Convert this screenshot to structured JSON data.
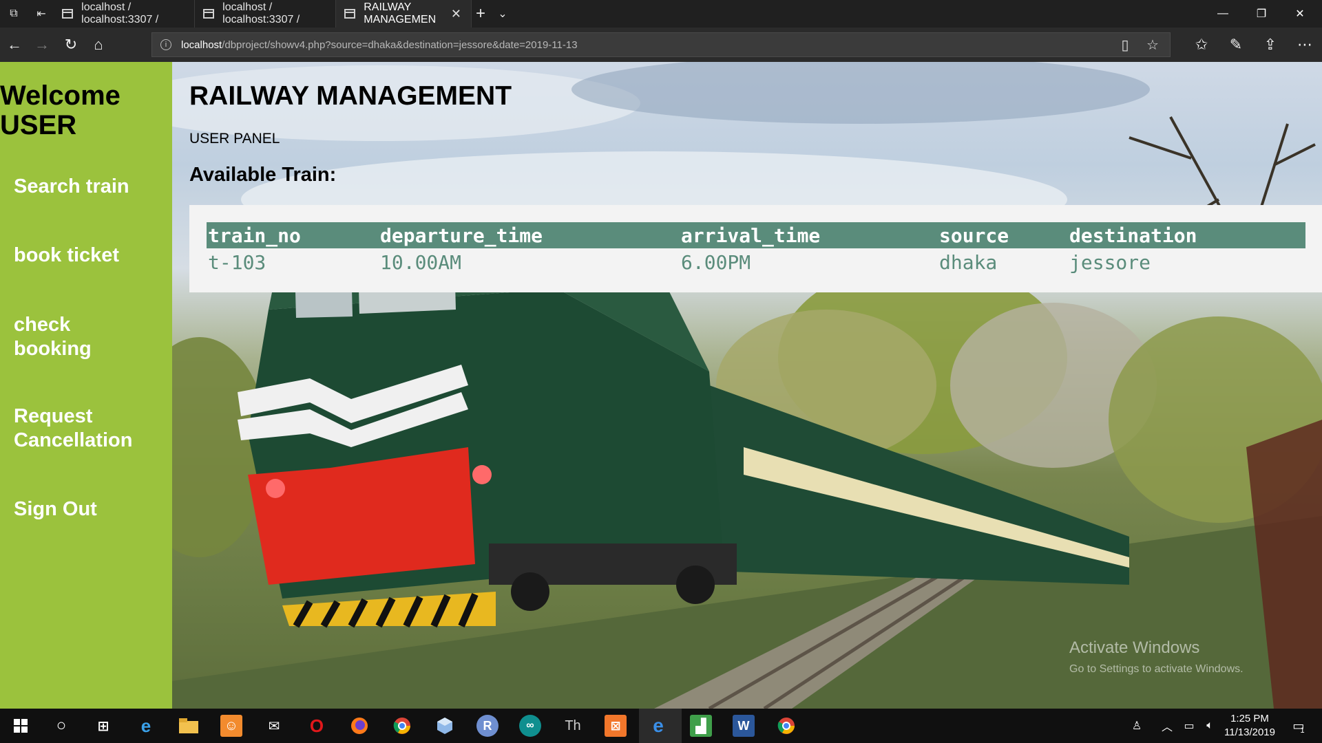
{
  "browser": {
    "tabs": [
      {
        "title": "localhost / localhost:3307 /"
      },
      {
        "title": "localhost / localhost:3307 /"
      },
      {
        "title": "RAILWAY MANAGEMEN"
      }
    ],
    "url_host": "localhost",
    "url_path": "/dbproject/showv4.php?source=dhaka&destination=jessore&date=2019-11-13"
  },
  "sidebar": {
    "welcome": "Welcome USER",
    "links": [
      {
        "label": "Search train"
      },
      {
        "label": "book ticket"
      },
      {
        "label": "check booking"
      },
      {
        "label": "Request Cancellation"
      },
      {
        "label": "Sign Out"
      }
    ]
  },
  "main": {
    "title": "RAILWAY MANAGEMENT",
    "panel": "USER PANEL",
    "heading": "Available Train:",
    "table": {
      "headers": [
        "train_no",
        "departure_time",
        "arrival_time",
        "source",
        "destination"
      ],
      "rows": [
        [
          "t-103",
          "10.00AM",
          "6.00PM",
          "dhaka",
          "jessore"
        ]
      ]
    }
  },
  "watermark": {
    "line1": "Activate Windows",
    "line2": "Go to Settings to activate Windows."
  },
  "taskbar": {
    "time": "1:25 PM",
    "date": "11/13/2019",
    "notifications": "1"
  },
  "colors": {
    "sidebar": "#9bc23d",
    "table_header": "#5a8c7b",
    "table_text": "#5a8c7b"
  }
}
